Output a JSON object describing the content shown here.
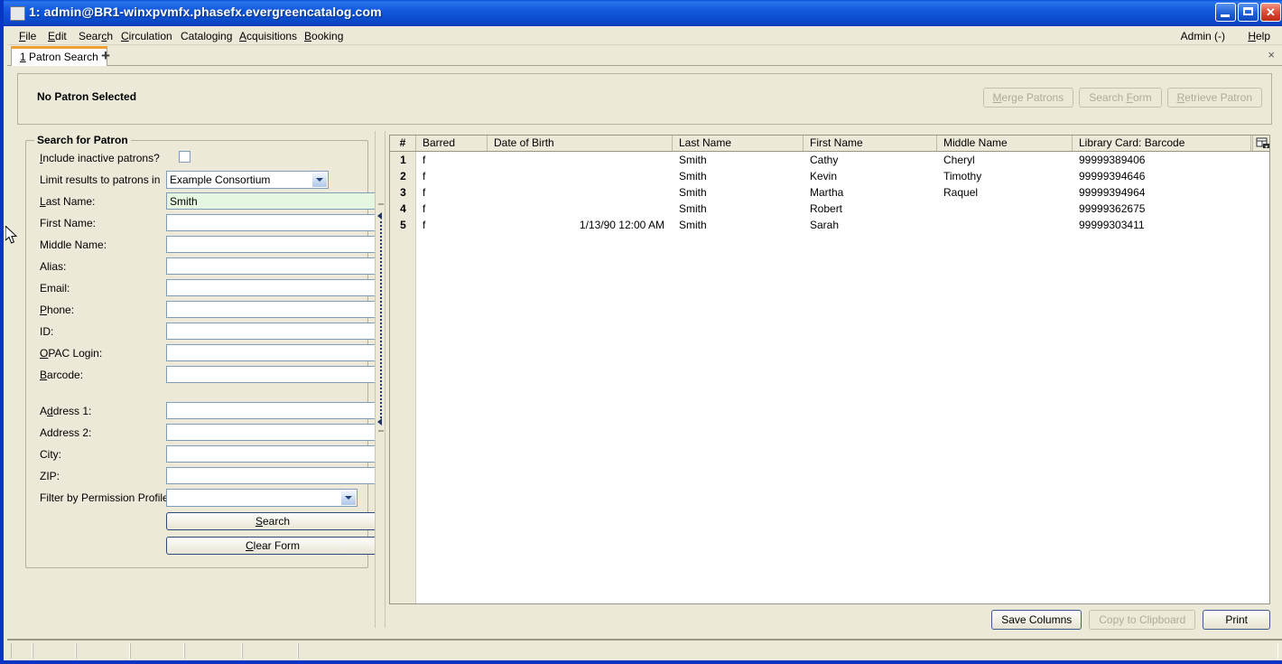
{
  "window": {
    "title": "1: admin@BR1-winxpvmfx.phasefx.evergreencatalog.com",
    "minimize_label": "",
    "maximize_label": "",
    "close_label": "",
    "accent_titlebar": "#0a48c8"
  },
  "menubar": {
    "items": [
      {
        "label": "File",
        "accel": "F"
      },
      {
        "label": "Edit",
        "accel": "E"
      },
      {
        "label": "Search",
        "accel": "c"
      },
      {
        "label": "Circulation",
        "accel": "C"
      },
      {
        "label": "Cataloging",
        "accel": "g"
      },
      {
        "label": "Acquisitions",
        "accel": "A"
      },
      {
        "label": "Booking",
        "accel": "B"
      }
    ],
    "right_items": [
      {
        "label": "Admin (-)"
      },
      {
        "label": "Help"
      }
    ]
  },
  "tabs": {
    "items": [
      {
        "number": "1",
        "label": "Patron Search"
      }
    ],
    "add_label": "+",
    "close_label": "×"
  },
  "patron_header": {
    "title": "No Patron Selected",
    "buttons": [
      {
        "label": "Merge Patrons",
        "enabled": false
      },
      {
        "label": "Search Form",
        "enabled": false
      },
      {
        "label": "Retrieve Patron",
        "enabled": false
      }
    ]
  },
  "search_form": {
    "legend": "Search for Patron",
    "fields": [
      {
        "label": "Include inactive patrons?",
        "type": "checkbox",
        "value": "",
        "checked": false
      },
      {
        "label": "Limit results to patrons in",
        "type": "select",
        "value": "Example Consortium"
      },
      {
        "label": "Last Name:",
        "type": "text",
        "value": "Smith",
        "focused": true
      },
      {
        "label": "First Name:",
        "type": "text",
        "value": ""
      },
      {
        "label": "Middle Name:",
        "type": "text",
        "value": ""
      },
      {
        "label": "Alias:",
        "type": "text",
        "value": ""
      },
      {
        "label": "Email:",
        "type": "text",
        "value": ""
      },
      {
        "label": "Phone:",
        "type": "text",
        "value": ""
      },
      {
        "label": "ID:",
        "type": "text",
        "value": ""
      },
      {
        "label": "OPAC Login:",
        "type": "text",
        "value": ""
      },
      {
        "label": "Barcode:",
        "type": "text",
        "value": ""
      },
      {
        "label": "Address 1:",
        "type": "text",
        "value": ""
      },
      {
        "label": "Address 2:",
        "type": "text",
        "value": ""
      },
      {
        "label": "City:",
        "type": "text",
        "value": ""
      },
      {
        "label": "ZIP:",
        "type": "text",
        "value": ""
      },
      {
        "label": "Filter by Permission Profile:",
        "type": "select",
        "value": ""
      }
    ],
    "search_button": "Search",
    "clear_button": "Clear Form"
  },
  "results": {
    "columns": [
      "#",
      "Barred",
      "Date of Birth",
      "Last Name",
      "First Name",
      "Middle Name",
      "Library Card: Barcode"
    ],
    "rows": [
      {
        "num": "1",
        "barred": "f",
        "dob": "",
        "last": "Smith",
        "first": "Cathy",
        "middle": "Cheryl",
        "barcode": "99999389406"
      },
      {
        "num": "2",
        "barred": "f",
        "dob": "",
        "last": "Smith",
        "first": "Kevin",
        "middle": "Timothy",
        "barcode": "99999394646"
      },
      {
        "num": "3",
        "barred": "f",
        "dob": "",
        "last": "Smith",
        "first": "Martha",
        "middle": "Raquel",
        "barcode": "99999394964"
      },
      {
        "num": "4",
        "barred": "f",
        "dob": "",
        "last": "Smith",
        "first": "Robert",
        "middle": "",
        "barcode": "99999362675"
      },
      {
        "num": "5",
        "barred": "f",
        "dob": "1/13/90 12:00 AM",
        "last": "Smith",
        "first": "Sarah",
        "middle": "",
        "barcode": "99999303411"
      }
    ],
    "footer_buttons": [
      {
        "label": "Save Columns",
        "enabled": true
      },
      {
        "label": "Copy to Clipboard",
        "enabled": false
      },
      {
        "label": "Print",
        "enabled": true
      }
    ]
  },
  "statusbar": {
    "segments": [
      "",
      "",
      "",
      "",
      "",
      "",
      ""
    ]
  }
}
